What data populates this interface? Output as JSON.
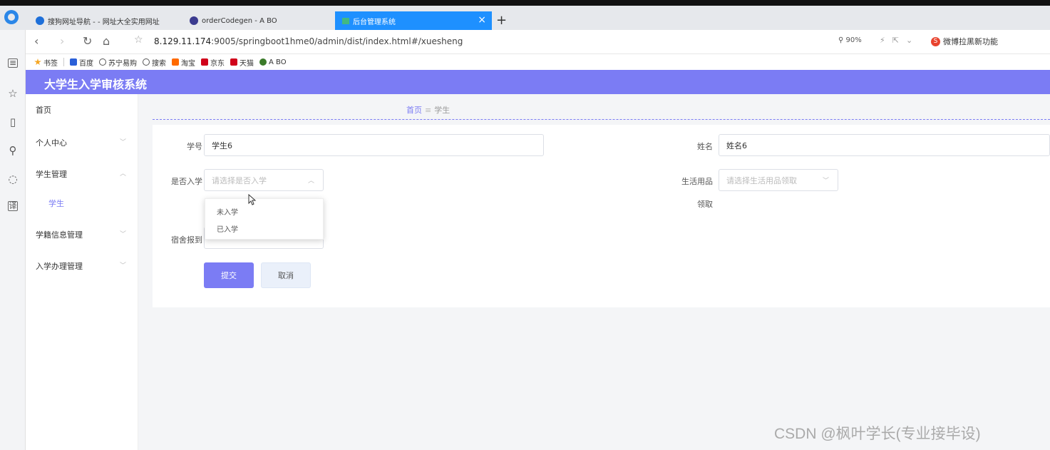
{
  "browser": {
    "tabs": [
      {
        "label": "搜狗网址导航 - - 网址大全实用网址",
        "active": false
      },
      {
        "label": "orderCodegen - A BO",
        "active": false
      },
      {
        "label": "后台管理系统",
        "active": true
      }
    ],
    "new_tab": "+",
    "tab_close": "×",
    "url_host": "8.129.11.174",
    "url_path": ":9005/springboot1hme0/admin/dist/index.html#/xuesheng",
    "zoom": "90%",
    "weibo_label": "微博拉黑新功能",
    "bookmarks": [
      "书签",
      "百度",
      "苏宁易购",
      "搜索",
      "淘宝",
      "京东",
      "天猫",
      "A BO"
    ]
  },
  "app": {
    "title": "大学生入学审核系统"
  },
  "sidebar": {
    "items": [
      {
        "label": "首页"
      },
      {
        "label": "个人中心"
      },
      {
        "label": "学生管理"
      },
      {
        "label": "学生"
      },
      {
        "label": "学籍信息管理"
      },
      {
        "label": "入学办理管理"
      }
    ]
  },
  "breadcrumb": {
    "home": "首页",
    "sep": "≡",
    "current": "学生"
  },
  "form": {
    "xuehao_label": "学号",
    "xuehao_value": "学生6",
    "xingming_label": "姓名",
    "xingming_value": "姓名6",
    "ruxue_label": "是否入学",
    "ruxue_placeholder": "请选择是否入学",
    "yongpin_label": "生活用品",
    "yongpin_label2": "领取",
    "yongpin_placeholder": "请选择生活用品领取",
    "sushe_label": "宿舍报到",
    "submit": "提交",
    "cancel": "取消"
  },
  "dropdown": {
    "options": [
      "未入学",
      "已入学"
    ]
  },
  "watermark": "CSDN @枫叶学长(专业接毕设)",
  "colors": {
    "accent": "#7b7cf4",
    "tab_active": "#1e90ff"
  }
}
